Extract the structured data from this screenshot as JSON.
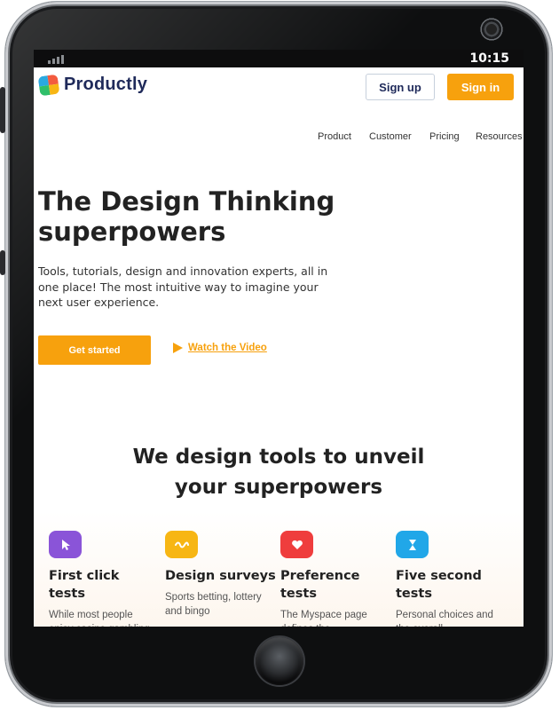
{
  "device": {
    "time": "10:15"
  },
  "brand": {
    "name": "Productly"
  },
  "header": {
    "signup_label": "Sign up",
    "signin_label": "Sign in"
  },
  "nav": {
    "items": [
      "Product",
      "Customer",
      "Pricing",
      "Resources"
    ]
  },
  "hero": {
    "title": "The Design Thinking superpowers",
    "subtitle": "Tools, tutorials, design and innovation experts, all in one place! The most intuitive way to imagine your next user experience.",
    "cta_label": "Get started",
    "video_label": "Watch the Video"
  },
  "section": {
    "title": "We design tools to unveil your superpowers",
    "features": [
      {
        "title": "First click tests",
        "desc": "While most people enjoy casino gambling",
        "icon": "cursor-icon",
        "color": "#8a54d8"
      },
      {
        "title": "Design surveys",
        "desc": "Sports betting, lottery and bingo",
        "icon": "wave-icon",
        "color": "#f7b614"
      },
      {
        "title": "Preference tests",
        "desc": "The Myspace page defines the",
        "icon": "heart-icon",
        "color": "#ef3d3d"
      },
      {
        "title": "Five second tests",
        "desc": "Personal choices and the overall",
        "icon": "hourglass-icon",
        "color": "#21a7e8"
      }
    ]
  },
  "colors": {
    "accent": "#f7a10d",
    "brand_text": "#1f2a5a"
  }
}
